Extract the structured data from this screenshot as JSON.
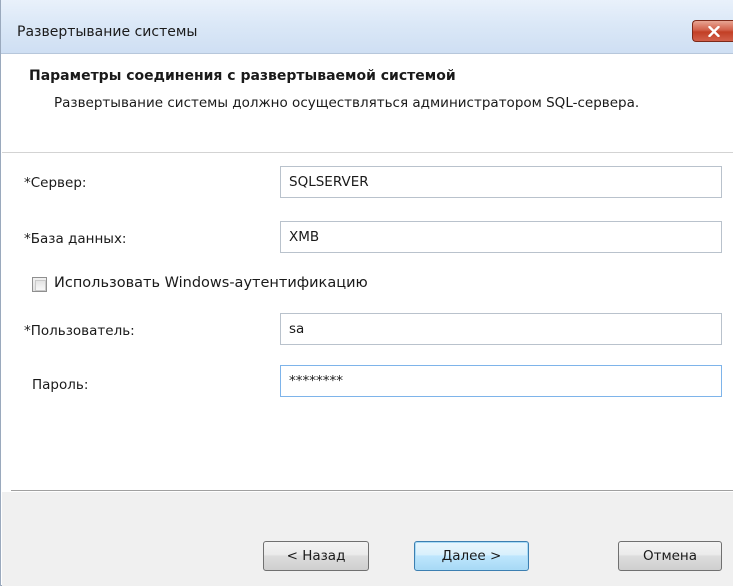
{
  "window": {
    "title": "Развертывание системы",
    "close_glyph": "✕"
  },
  "header": {
    "title": "Параметры соединения с развертываемой системой",
    "description": "Развертывание системы должно осуществляться администратором SQL-сервера."
  },
  "form": {
    "server": {
      "label": "*Сервер:",
      "value": "SQLSERVER"
    },
    "database": {
      "label": "*База данных:",
      "value": "XMB"
    },
    "windows_auth": {
      "label": "Использовать Windows-аутентификацию",
      "checked": false
    },
    "user": {
      "label": "*Пользователь:",
      "value": "sa"
    },
    "password": {
      "label": "Пароль:",
      "value": "********"
    }
  },
  "buttons": {
    "back": "< Назад",
    "next": "Далее >",
    "cancel": "Отмена"
  },
  "colors": {
    "title_bar": "#dbe8f7",
    "close_button": "#c7472d",
    "focus_border": "#7eb4ea",
    "default_button": "#bee6fd"
  }
}
